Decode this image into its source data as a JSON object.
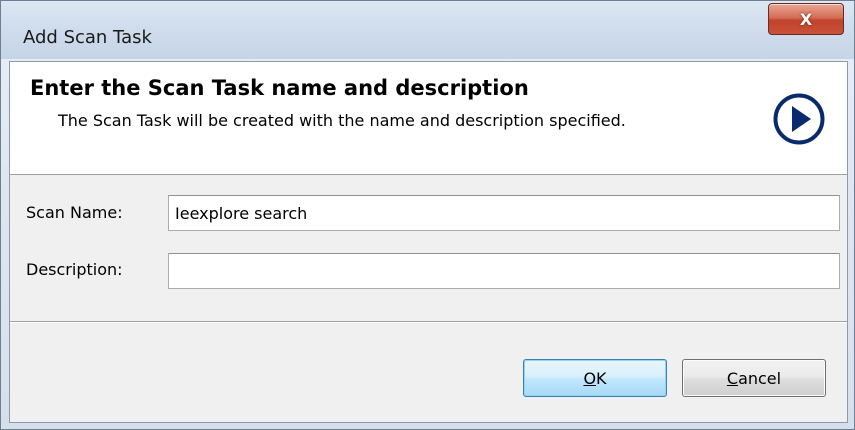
{
  "window": {
    "title": "Add Scan Task",
    "close_glyph": "X"
  },
  "header": {
    "title": "Enter the Scan Task name and description",
    "subtitle": "The Scan Task will be created with the name and description specified.",
    "icon": "next-arrow-circle-icon"
  },
  "form": {
    "scan_name_label": "Scan Name:",
    "scan_name_value": "Ieexplore search",
    "description_label": "Description:",
    "description_value": ""
  },
  "buttons": {
    "ok_mnemonic": "O",
    "ok_rest": "K",
    "cancel_mnemonic": "C",
    "cancel_rest": "ancel"
  },
  "colors": {
    "accent": "#0a2a6e",
    "close_button": "#c7492f",
    "default_button_border": "#3c7fb1"
  }
}
